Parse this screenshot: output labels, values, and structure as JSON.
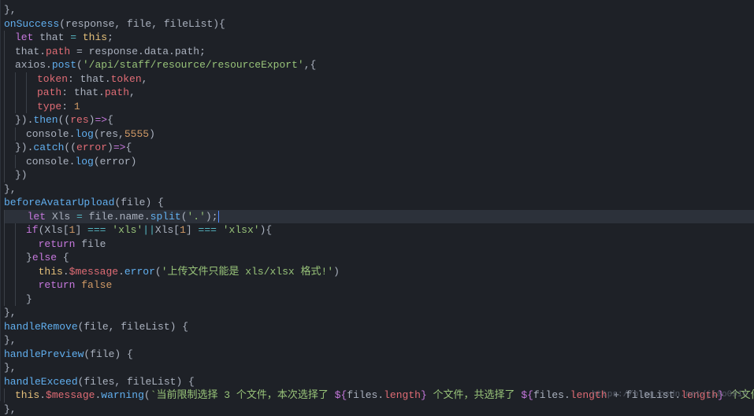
{
  "watermark": "https://blog.csdn.net/jiao0916",
  "code": {
    "l1": "},",
    "l2_a": "onSuccess",
    "l2_b": "(response, file, fileList){",
    "l3_a": "let",
    "l3_b": " that ",
    "l3_c": "=",
    "l3_d": "this",
    "l3_e": ";",
    "l4_a": "that.",
    "l4_b": "path",
    "l4_c": " = ",
    "l4_d": "response.data.path",
    "l4_e": ";",
    "l5_a": "axios.",
    "l5_b": "post",
    "l5_c": "(",
    "l5_d": "'/api/staff/resource/resourceExport'",
    "l5_e": ",{",
    "l6_a": "token",
    "l6_b": ": that.",
    "l6_c": "token",
    "l6_d": ",",
    "l7_a": "path",
    "l7_b": ": that.",
    "l7_c": "path",
    "l7_d": ",",
    "l8_a": "type",
    "l8_b": ": ",
    "l8_c": "1",
    "l9_a": "}).",
    "l9_b": "then",
    "l9_c": "((",
    "l9_d": "res",
    "l9_e": ")",
    "l9_f": "=>",
    "l9_g": "{",
    "l10_a": "console",
    "l10_b": ".",
    "l10_c": "log",
    "l10_d": "(res,",
    "l10_e": "5555",
    "l10_f": ")",
    "l11_a": "}).",
    "l11_b": "catch",
    "l11_c": "((",
    "l11_d": "error",
    "l11_e": ")",
    "l11_f": "=>",
    "l11_g": "{",
    "l12_a": "console",
    "l12_b": ".",
    "l12_c": "log",
    "l12_d": "(error)",
    "l13": "})",
    "l14": "},",
    "l15_a": "beforeAvatarUpload",
    "l15_b": "(file) {",
    "l16_a": "let",
    "l16_b": " Xls ",
    "l16_c": "=",
    "l16_d": " file.name.",
    "l16_e": "split",
    "l16_f": "(",
    "l16_g": "'.'",
    "l16_h": ");",
    "l17_a": "if",
    "l17_b": "(Xls[",
    "l17_c": "1",
    "l17_d": "] ",
    "l17_e": "===",
    "l17_f": " ",
    "l17_g": "'xls'",
    "l17_h": "||",
    "l17_i": "Xls[",
    "l17_j": "1",
    "l17_k": "] ",
    "l17_l": "===",
    "l17_m": " ",
    "l17_n": "'xlsx'",
    "l17_o": "){",
    "l18_a": "return",
    "l18_b": " file",
    "l19_a": "}",
    "l19_b": "else",
    "l19_c": " {",
    "l20_a": "this",
    "l20_b": ".",
    "l20_c": "$message",
    "l20_d": ".",
    "l20_e": "error",
    "l20_f": "(",
    "l20_g": "'上传文件只能是 xls/xlsx 格式!'",
    "l20_h": ")",
    "l21_a": "return",
    "l21_b": " ",
    "l21_c": "false",
    "l22": "}",
    "l23": "},",
    "l24_a": "handleRemove",
    "l24_b": "(file, fileList) {",
    "l25": "},",
    "l26_a": "handlePreview",
    "l26_b": "(file) {",
    "l27": "},",
    "l28_a": "handleExceed",
    "l28_b": "(files, fileList) {",
    "l29_a": "this",
    "l29_b": ".",
    "l29_c": "$message",
    "l29_d": ".",
    "l29_e": "warning",
    "l29_f": "(",
    "l29_g": "`当前限制选择 3 个文件，本次选择了 ",
    "l29_h": "${",
    "l29_i": "files.",
    "l29_j": "length",
    "l29_k": "}",
    "l29_l": " 个文件，共选择了 ",
    "l29_m": "${",
    "l29_n": "files.",
    "l29_o": "length",
    "l29_p": " + fileList.",
    "l29_q": "length",
    "l29_r": "}",
    "l29_s": " 个文件`",
    "l29_t": ");",
    "l30": "},"
  }
}
